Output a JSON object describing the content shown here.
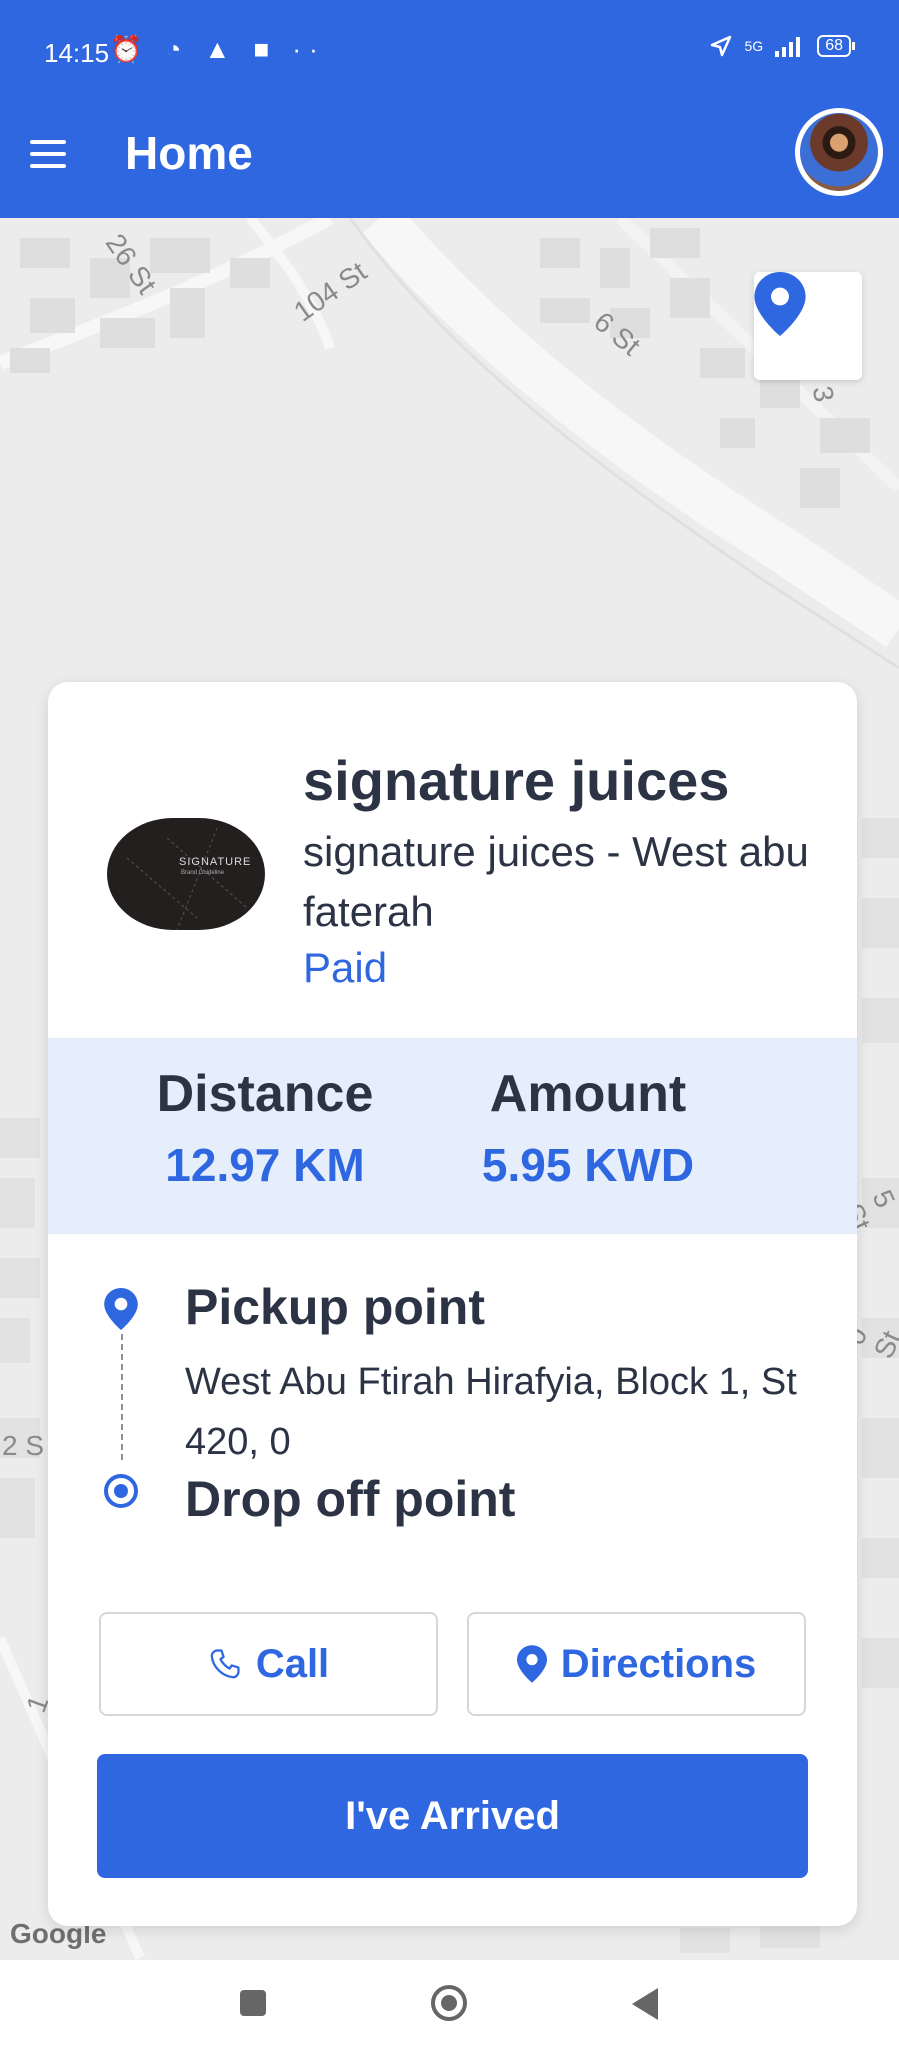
{
  "status_bar": {
    "time": "14:15",
    "left_icons": "⏰ ◔ ▲ ■ ··",
    "network": "5G",
    "battery": "68"
  },
  "app_bar": {
    "title": "Home",
    "menu_icon": "hamburger-icon",
    "avatar_icon": "user-avatar"
  },
  "map": {
    "street_labels": [
      "26 St",
      "104 St",
      "6 St",
      "3",
      "2 S",
      "5 St",
      "0 St",
      "1"
    ],
    "locate_icon": "location-pin-icon",
    "attribution": "Google"
  },
  "order": {
    "store_logo_text": "SIGNATURE",
    "store_logo_subtext": "Brand Guideline",
    "store_name": "signature juices",
    "store_branch": "signature juices - West abu faterah",
    "payment_status": "Paid",
    "distance_label": "Distance",
    "distance_value": "12.97 KM",
    "amount_label": "Amount",
    "amount_value": "5.95 KWD",
    "pickup_title": "Pickup point",
    "pickup_address": "West Abu Ftirah Hirafyia, Block 1, St 420, 0",
    "dropoff_title": "Drop off point",
    "call_label": "Call",
    "directions_label": "Directions",
    "arrived_label": "I've Arrived"
  },
  "colors": {
    "primary": "#2f67e1",
    "text": "#2b3344",
    "stats_bg": "#e6eefb"
  }
}
